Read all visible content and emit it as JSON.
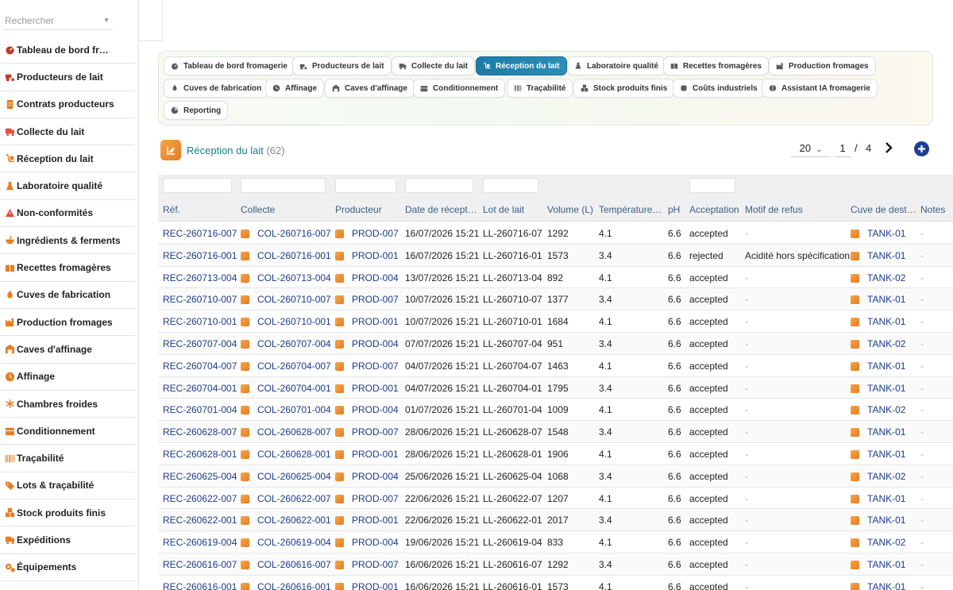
{
  "sidebar": {
    "search_placeholder": "Rechercher",
    "items": [
      {
        "label": "Tableau de bord fromagerie",
        "icon": "dashboard-icon",
        "color": "#c0392b"
      },
      {
        "label": "Producteurs de lait",
        "icon": "tractor-icon",
        "color": "#c0392b"
      },
      {
        "label": "Contrats producteurs",
        "icon": "contract-icon",
        "color": "#e67e22"
      },
      {
        "label": "Collecte du lait",
        "icon": "truck-icon",
        "color": "#e74c3c"
      },
      {
        "label": "Réception du lait",
        "icon": "dolly-icon",
        "color": "#e67e22"
      },
      {
        "label": "Laboratoire qualité",
        "icon": "flask-icon",
        "color": "#e67e22"
      },
      {
        "label": "Non-conformités",
        "icon": "warning-icon",
        "color": "#e74c3c"
      },
      {
        "label": "Ingrédients & ferments",
        "icon": "bowl-icon",
        "color": "#e67e22"
      },
      {
        "label": "Recettes fromagères",
        "icon": "book-icon",
        "color": "#e67e22"
      },
      {
        "label": "Cuves de fabrication",
        "icon": "drop-icon",
        "color": "#e67e22"
      },
      {
        "label": "Production fromages",
        "icon": "factory-icon",
        "color": "#e67e22"
      },
      {
        "label": "Caves d'affinage",
        "icon": "warehouse-icon",
        "color": "#e67e22"
      },
      {
        "label": "Affinage",
        "icon": "clock-icon",
        "color": "#e67e22"
      },
      {
        "label": "Chambres froides",
        "icon": "snowflake-icon",
        "color": "#e67e22"
      },
      {
        "label": "Conditionnement",
        "icon": "box-icon",
        "color": "#e67e22"
      },
      {
        "label": "Traçabilité",
        "icon": "barcode-icon",
        "color": "#e67e22"
      },
      {
        "label": "Lots & traçabilité",
        "icon": "tags-icon",
        "color": "#e67e22"
      },
      {
        "label": "Stock produits finis",
        "icon": "boxes-icon",
        "color": "#e67e22"
      },
      {
        "label": "Expéditions",
        "icon": "shipping-icon",
        "color": "#e67e22"
      },
      {
        "label": "Équipements",
        "icon": "gears-icon",
        "color": "#e67e22"
      }
    ]
  },
  "modules": [
    {
      "label": "Tableau de bord fromagerie",
      "icon": "dashboard-icon"
    },
    {
      "label": "Producteurs de lait",
      "icon": "tractor-icon"
    },
    {
      "label": "Collecte du lait",
      "icon": "truck-icon"
    },
    {
      "label": "Réception du lait",
      "icon": "dolly-icon",
      "active": true
    },
    {
      "label": "Laboratoire qualité",
      "icon": "flask-icon"
    },
    {
      "label": "Recettes fromagères",
      "icon": "book-icon"
    },
    {
      "label": "Production fromages",
      "icon": "factory-icon"
    },
    {
      "label": "Cuves de fabrication",
      "icon": "drop-icon"
    },
    {
      "label": "Affinage",
      "icon": "clock-icon"
    },
    {
      "label": "Caves d'affinage",
      "icon": "warehouse-icon"
    },
    {
      "label": "Conditionnement",
      "icon": "box-icon"
    },
    {
      "label": "Traçabilité",
      "icon": "barcode-icon"
    },
    {
      "label": "Stock produits finis",
      "icon": "boxes-icon"
    },
    {
      "label": "Coûts industriels",
      "icon": "coins-icon"
    },
    {
      "label": "Assistant IA fromagerie",
      "icon": "brain-icon"
    },
    {
      "label": "Reporting",
      "icon": "pie-icon"
    }
  ],
  "page": {
    "title": "Réception du lait",
    "count": "(62)",
    "page_size": "20",
    "current_page": "1",
    "page_sep": "/",
    "total_pages": "4"
  },
  "table": {
    "columns": [
      "Réf.",
      "Collecte",
      "Producteur",
      "Date de réception",
      "Lot de lait",
      "Volume (L)",
      "Température (°C)",
      "pH",
      "Acceptation",
      "Motif de refus",
      "Cuve de destination",
      "Notes"
    ],
    "rows": [
      [
        "REC-260716-007",
        "COL-260716-007",
        "PROD-007",
        "16/07/2026 15:21",
        "LL-260716-07",
        "1292",
        "4.1",
        "6.6",
        "accepted",
        "-",
        "TANK-01",
        "-"
      ],
      [
        "REC-260716-001",
        "COL-260716-001",
        "PROD-001",
        "16/07/2026 15:21",
        "LL-260716-01",
        "1573",
        "3.4",
        "6.6",
        "rejected",
        "Acidité hors spécification",
        "TANK-01",
        "-"
      ],
      [
        "REC-260713-004",
        "COL-260713-004",
        "PROD-004",
        "13/07/2026 15:21",
        "LL-260713-04",
        "892",
        "4.1",
        "6.6",
        "accepted",
        "-",
        "TANK-02",
        "-"
      ],
      [
        "REC-260710-007",
        "COL-260710-007",
        "PROD-007",
        "10/07/2026 15:21",
        "LL-260710-07",
        "1377",
        "3.4",
        "6.6",
        "accepted",
        "-",
        "TANK-01",
        "-"
      ],
      [
        "REC-260710-001",
        "COL-260710-001",
        "PROD-001",
        "10/07/2026 15:21",
        "LL-260710-01",
        "1684",
        "4.1",
        "6.6",
        "accepted",
        "-",
        "TANK-01",
        "-"
      ],
      [
        "REC-260707-004",
        "COL-260707-004",
        "PROD-004",
        "07/07/2026 15:21",
        "LL-260707-04",
        "951",
        "3.4",
        "6.6",
        "accepted",
        "-",
        "TANK-02",
        "-"
      ],
      [
        "REC-260704-007",
        "COL-260704-007",
        "PROD-007",
        "04/07/2026 15:21",
        "LL-260704-07",
        "1463",
        "4.1",
        "6.6",
        "accepted",
        "-",
        "TANK-01",
        "-"
      ],
      [
        "REC-260704-001",
        "COL-260704-001",
        "PROD-001",
        "04/07/2026 15:21",
        "LL-260704-01",
        "1795",
        "3.4",
        "6.6",
        "accepted",
        "-",
        "TANK-01",
        "-"
      ],
      [
        "REC-260701-004",
        "COL-260701-004",
        "PROD-004",
        "01/07/2026 15:21",
        "LL-260701-04",
        "1009",
        "4.1",
        "6.6",
        "accepted",
        "-",
        "TANK-02",
        "-"
      ],
      [
        "REC-260628-007",
        "COL-260628-007",
        "PROD-007",
        "28/06/2026 15:21",
        "LL-260628-07",
        "1548",
        "3.4",
        "6.6",
        "accepted",
        "-",
        "TANK-01",
        "-"
      ],
      [
        "REC-260628-001",
        "COL-260628-001",
        "PROD-001",
        "28/06/2026 15:21",
        "LL-260628-01",
        "1906",
        "4.1",
        "6.6",
        "accepted",
        "-",
        "TANK-01",
        "-"
      ],
      [
        "REC-260625-004",
        "COL-260625-004",
        "PROD-004",
        "25/06/2026 15:21",
        "LL-260625-04",
        "1068",
        "3.4",
        "6.6",
        "accepted",
        "-",
        "TANK-02",
        "-"
      ],
      [
        "REC-260622-007",
        "COL-260622-007",
        "PROD-007",
        "22/06/2026 15:21",
        "LL-260622-07",
        "1207",
        "4.1",
        "6.6",
        "accepted",
        "-",
        "TANK-01",
        "-"
      ],
      [
        "REC-260622-001",
        "COL-260622-001",
        "PROD-001",
        "22/06/2026 15:21",
        "LL-260622-01",
        "2017",
        "3.4",
        "6.6",
        "accepted",
        "-",
        "TANK-01",
        "-"
      ],
      [
        "REC-260619-004",
        "COL-260619-004",
        "PROD-004",
        "19/06/2026 15:21",
        "LL-260619-04",
        "833",
        "4.1",
        "6.6",
        "accepted",
        "-",
        "TANK-02",
        "-"
      ],
      [
        "REC-260616-007",
        "COL-260616-007",
        "PROD-007",
        "16/06/2026 15:21",
        "LL-260616-07",
        "1292",
        "3.4",
        "6.6",
        "accepted",
        "-",
        "TANK-01",
        "-"
      ],
      [
        "REC-260616-001",
        "COL-260616-001",
        "PROD-001",
        "16/06/2026 15:21",
        "LL-260616-01",
        "1573",
        "4.1",
        "6.6",
        "accepted",
        "-",
        "TANK-01",
        "-"
      ]
    ]
  },
  "colors": {
    "accent": "#1f7aa8",
    "title": "#1b7f8c",
    "link": "#1c3c8c",
    "header_text": "#3a5f86",
    "icon_orange": "#e77b22"
  }
}
